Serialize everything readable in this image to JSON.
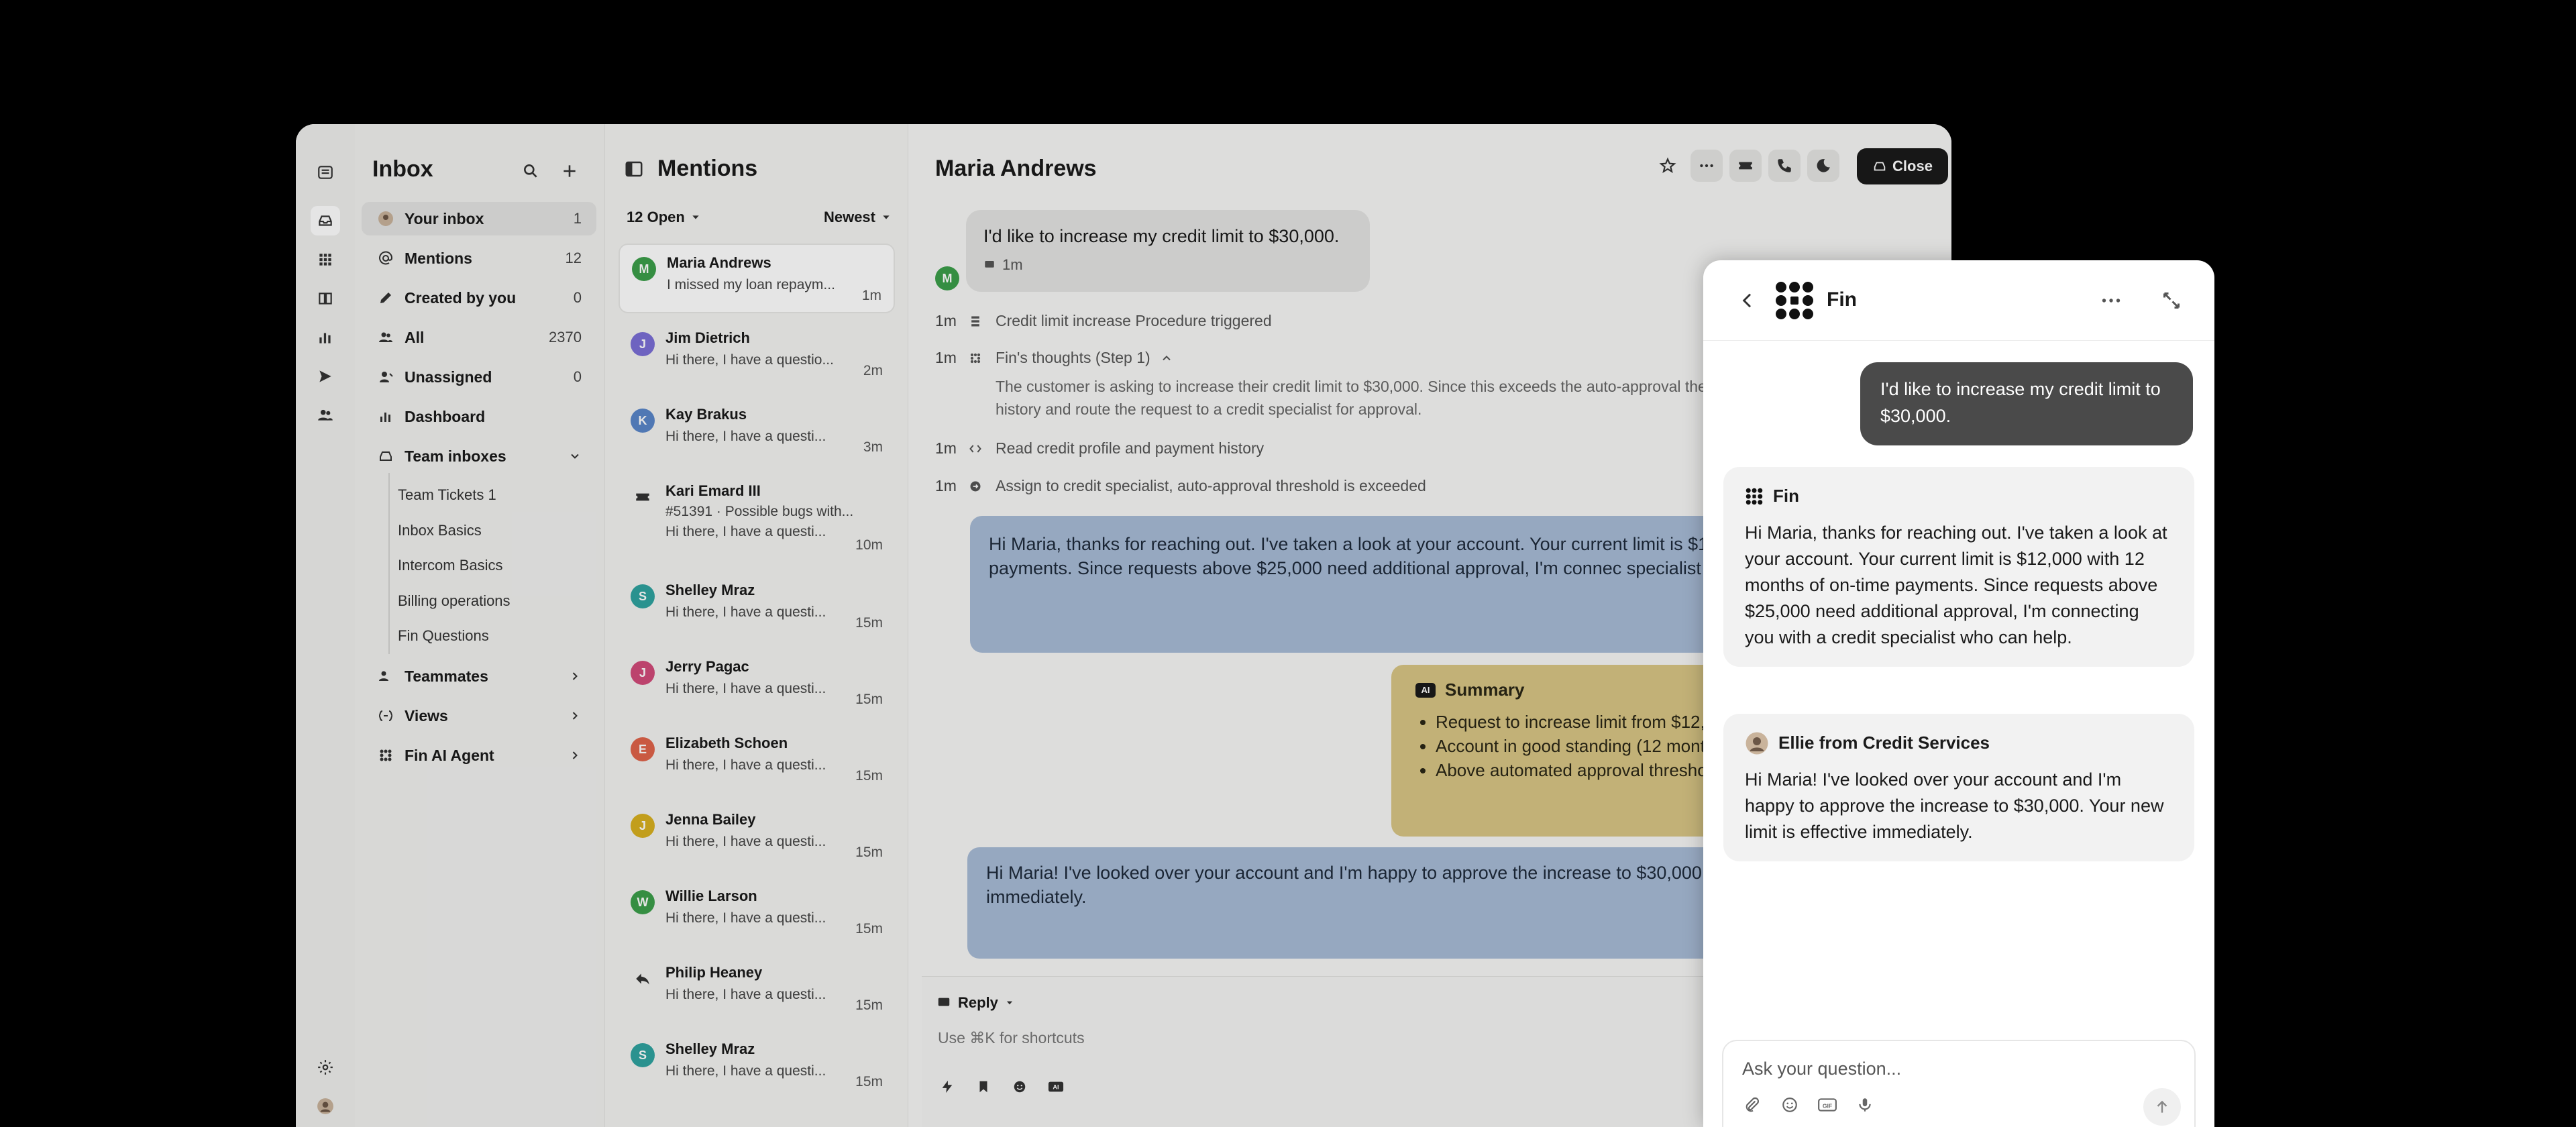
{
  "colors": {
    "background": "#000000",
    "app_bg": "#f5f5f4",
    "fin_bubble": "#a8bcd6",
    "summary_bubble": "#d9c685",
    "user_bubble_dark": "#4a4a4a"
  },
  "rail": {
    "icons": [
      "inbox-icon",
      "apps-icon",
      "book-icon",
      "chart-icon",
      "send-icon",
      "people-icon",
      "gear-icon",
      "avatar"
    ]
  },
  "nav": {
    "title": "Inbox",
    "items": [
      {
        "label": "Your inbox",
        "count": "1",
        "icon": "avatar"
      },
      {
        "label": "Mentions",
        "count": "12",
        "icon": "at-icon"
      },
      {
        "label": "Created by you",
        "count": "0",
        "icon": "pen-icon"
      },
      {
        "label": "All",
        "count": "2370",
        "icon": "people-icon"
      },
      {
        "label": "Unassigned",
        "count": "0",
        "icon": "person-icon"
      },
      {
        "label": "Dashboard",
        "count": "",
        "icon": "chart-icon"
      }
    ],
    "team_inboxes": {
      "label": "Team inboxes",
      "children": [
        "Team Tickets 1",
        "Inbox Basics",
        "Intercom Basics",
        "Billing operations",
        "Fin Questions"
      ]
    },
    "sections": [
      {
        "label": "Teammates",
        "icon": "people-icon"
      },
      {
        "label": "Views",
        "icon": "views-icon"
      },
      {
        "label": "Fin AI Agent",
        "icon": "fin-icon"
      }
    ]
  },
  "list": {
    "title": "Mentions",
    "filter": "12 Open",
    "sort": "Newest",
    "conversations": [
      {
        "initial": "M",
        "color": "#3b9f4a",
        "name": "Maria Andrews",
        "preview": "I missed my loan repaym...",
        "time": "1m"
      },
      {
        "initial": "J",
        "color": "#7b6fd6",
        "name": "Jim Dietrich",
        "preview": "Hi there, I have a questio...",
        "time": "2m"
      },
      {
        "initial": "K",
        "color": "#5a86c9",
        "name": "Kay Brakus",
        "preview": "Hi there, I have a questi...",
        "time": "3m"
      },
      {
        "initial": "",
        "color": "",
        "name": "Kari Emard III",
        "line2": "#51391 · Possible bugs with...",
        "preview": "Hi there, I have a questi...",
        "time": "10m"
      },
      {
        "initial": "S",
        "color": "#2fa3a0",
        "name": "Shelley Mraz",
        "preview": "Hi there, I have a questi...",
        "time": "15m"
      },
      {
        "initial": "J",
        "color": "#d24b7a",
        "name": "Jerry Pagac",
        "preview": "Hi there, I have a questi...",
        "time": "15m"
      },
      {
        "initial": "E",
        "color": "#e0644a",
        "name": "Elizabeth Schoen",
        "preview": "Hi there, I have a questi...",
        "time": "15m"
      },
      {
        "initial": "J",
        "color": "#d8b020",
        "name": "Jenna Bailey",
        "preview": "Hi there, I have a questi...",
        "time": "15m"
      },
      {
        "initial": "W",
        "color": "#3b9f4a",
        "name": "Willie Larson",
        "preview": "Hi there, I have a questi...",
        "time": "15m"
      },
      {
        "initial": "",
        "color": "",
        "name": "Philip Heaney",
        "preview": "Hi there, I have a questi...",
        "time": "15m"
      },
      {
        "initial": "S",
        "color": "#2fa3a0",
        "name": "Shelley Mraz",
        "preview": "Hi there, I have a questi...",
        "time": "15m"
      }
    ]
  },
  "convo": {
    "title": "Maria Andrews",
    "close_label": "Close",
    "user_message": "I'd like to increase my credit limit to $30,000.",
    "user_message_time": "1m",
    "user_initial": "M",
    "events": [
      {
        "time": "1m",
        "text": "Credit limit increase Procedure triggered"
      },
      {
        "time": "1m",
        "text": "Fin's thoughts (Step 1)"
      },
      {
        "time": "1m",
        "text": "Read credit profile and payment history"
      },
      {
        "time": "1m",
        "text": "Assign to credit specialist, auto-approval threshold is exceeded"
      }
    ],
    "thought_text": "The customer is asking to increase their credit limit to $30,000. Since this exceeds the auto-approval their account history and route the request to a credit specialist for approval.",
    "fin_reply": "Hi Maria, thanks for reaching out. I've taken a look at your account. Your current limit is $12 of on-time payments. Since requests above $25,000 need additional approval, I'm connec specialist who can help.",
    "summary": {
      "badge": "AI",
      "title": "Summary",
      "bullets": [
        "Request to increase limit from $12,00",
        "Account in good standing (12 months",
        "Above automated approval threshold,"
      ]
    },
    "admin_reply": "Hi Maria! I've looked over your account and I'm happy to approve the increase to $30,000. effective immediately.",
    "reply": {
      "mode": "Reply",
      "placeholder": "Use ⌘K for shortcuts"
    }
  },
  "fin": {
    "title": "Fin",
    "user_message": "I'd like to increase my credit limit to $30,000.",
    "fin_card": {
      "author": "Fin",
      "text": "Hi Maria, thanks for reaching out. I've taken a look at your account. Your current limit is $12,000 with 12 months of on-time payments. Since requests above $25,000 need additional approval, I'm connecting you with a credit specialist who can help."
    },
    "admin_card": {
      "author": "Ellie from Credit Services",
      "text": "Hi Maria! I've looked over your account and I'm happy to approve the increase to $30,000. Your new limit is effective immediately."
    },
    "input_placeholder": "Ask your question..."
  }
}
